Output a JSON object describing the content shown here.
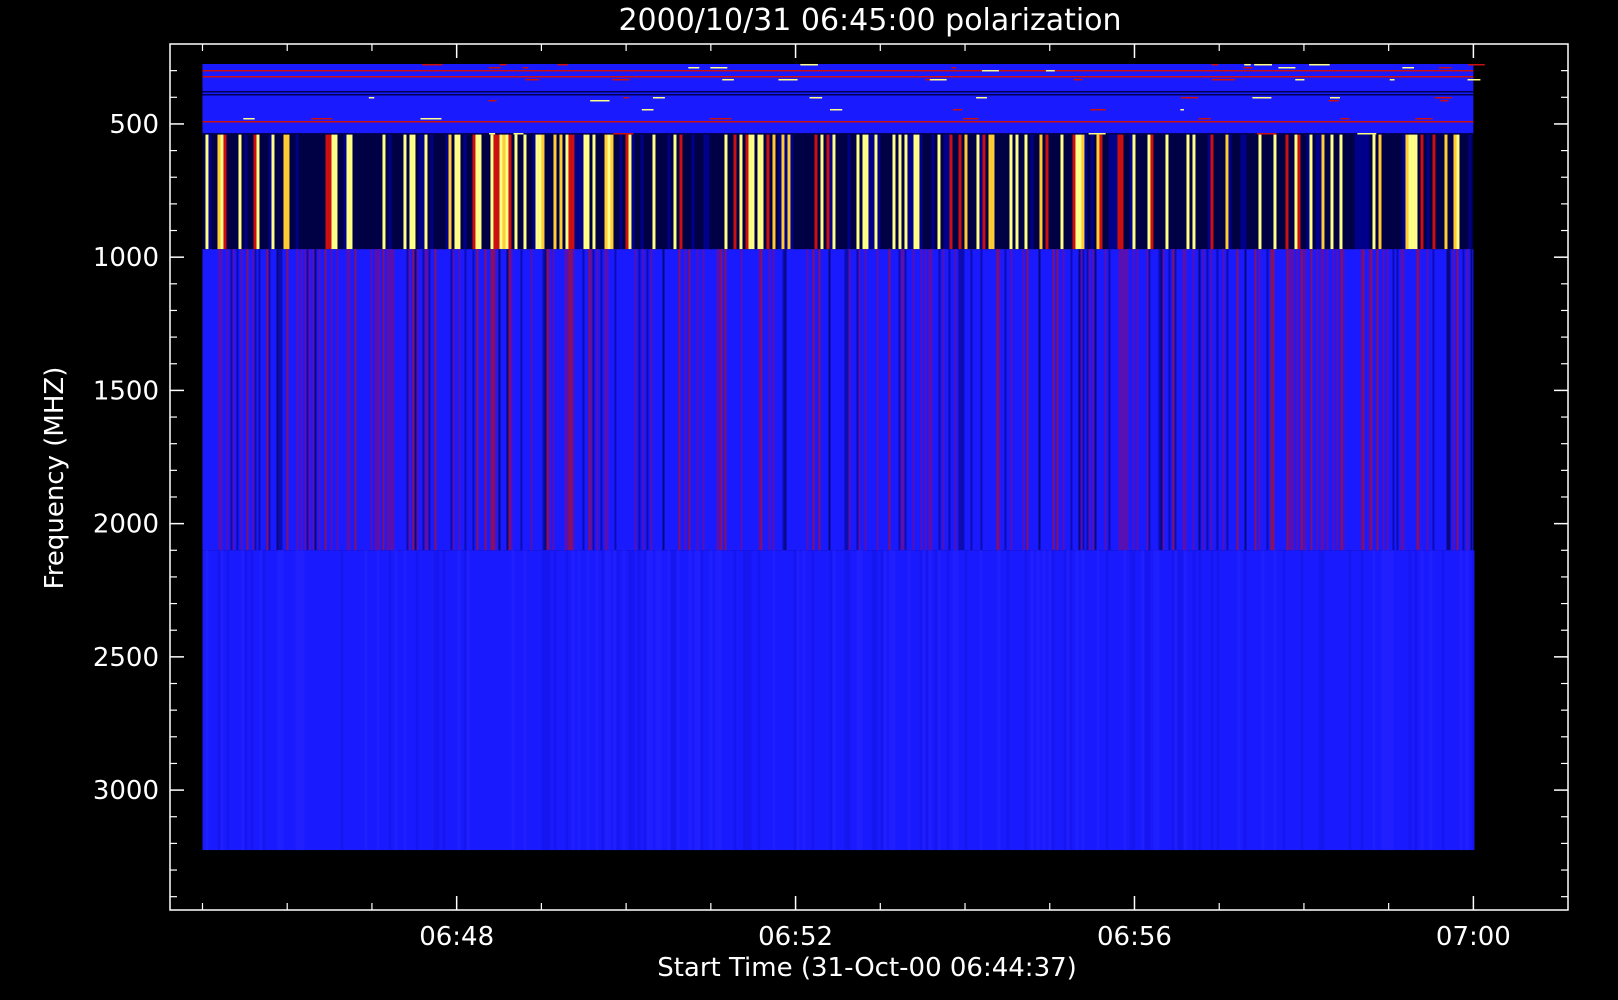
{
  "chart_data": {
    "type": "heatmap",
    "title": "2000/10/31 06:45:00 polarization",
    "xlabel": "Start Time (31-Oct-00 06:44:37)",
    "ylabel": "Frequency (MHZ)",
    "x_axis": {
      "type": "time",
      "range": [
        "06:44:37",
        "07:01:07"
      ],
      "major_ticks": [
        "06:48",
        "06:52",
        "06:56",
        "07:00"
      ],
      "minor_ticks": [
        "06:45",
        "06:46",
        "06:47",
        "06:49",
        "06:50",
        "06:51",
        "06:53",
        "06:54",
        "06:55",
        "06:57",
        "06:58",
        "06:59"
      ]
    },
    "y_axis": {
      "inverted": true,
      "range": [
        200,
        3450
      ],
      "major_ticks": [
        500,
        1000,
        1500,
        2000,
        2500,
        3000
      ],
      "tick_labels": [
        "500",
        "1000",
        "1500",
        "2000",
        "2500",
        "3000"
      ]
    },
    "data_extent": {
      "time_start": "06:45:00",
      "time_end": "07:00:00",
      "freq_min": 275,
      "freq_max": 3225
    },
    "bands": [
      {
        "name": "band-275-540",
        "freq_from": 275,
        "freq_to": 540,
        "pattern": "noisy-horizontal"
      },
      {
        "name": "band-540-970",
        "freq_from": 540,
        "freq_to": 970,
        "pattern": "bursts"
      },
      {
        "name": "band-970-2100",
        "freq_from": 970,
        "freq_to": 2100,
        "pattern": "vertical-stripes"
      },
      {
        "name": "band-2100-3225",
        "freq_from": 2100,
        "freq_to": 3225,
        "pattern": "uniform"
      }
    ],
    "colors": {
      "background": "#000000",
      "axes": "#ffffff",
      "low": "#000044",
      "mid": "#1a1aff",
      "high": "#cc1010",
      "peak": "#ffff88"
    },
    "grid": false,
    "legend": "none"
  }
}
